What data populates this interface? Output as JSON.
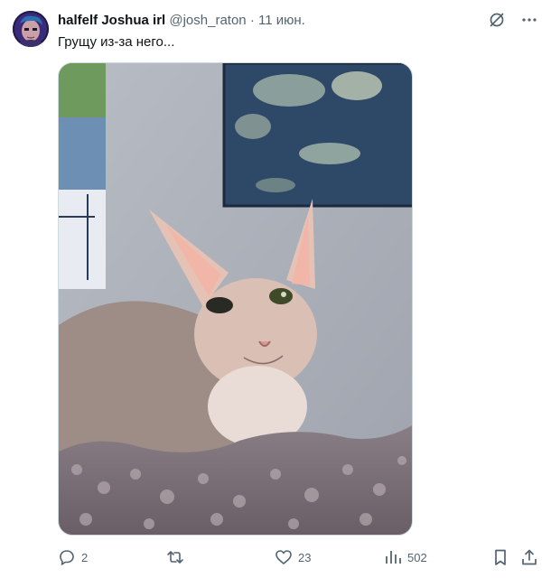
{
  "tweet": {
    "author": {
      "display_name": "halfelf Joshua irl",
      "handle": "@josh_raton",
      "separator": "·",
      "date": "11 июн."
    },
    "text": "Грущу из-за него...",
    "media": {
      "description_icon": "photo",
      "subject": "cat-photo"
    },
    "header_icons": [
      "grok-icon",
      "more-icon"
    ],
    "actions": {
      "replies": "2",
      "retweets": "",
      "likes": "23",
      "views": "502"
    },
    "colors": {
      "text_primary": "#0f1419",
      "text_secondary": "#536471",
      "border": "#cfd9de"
    }
  }
}
